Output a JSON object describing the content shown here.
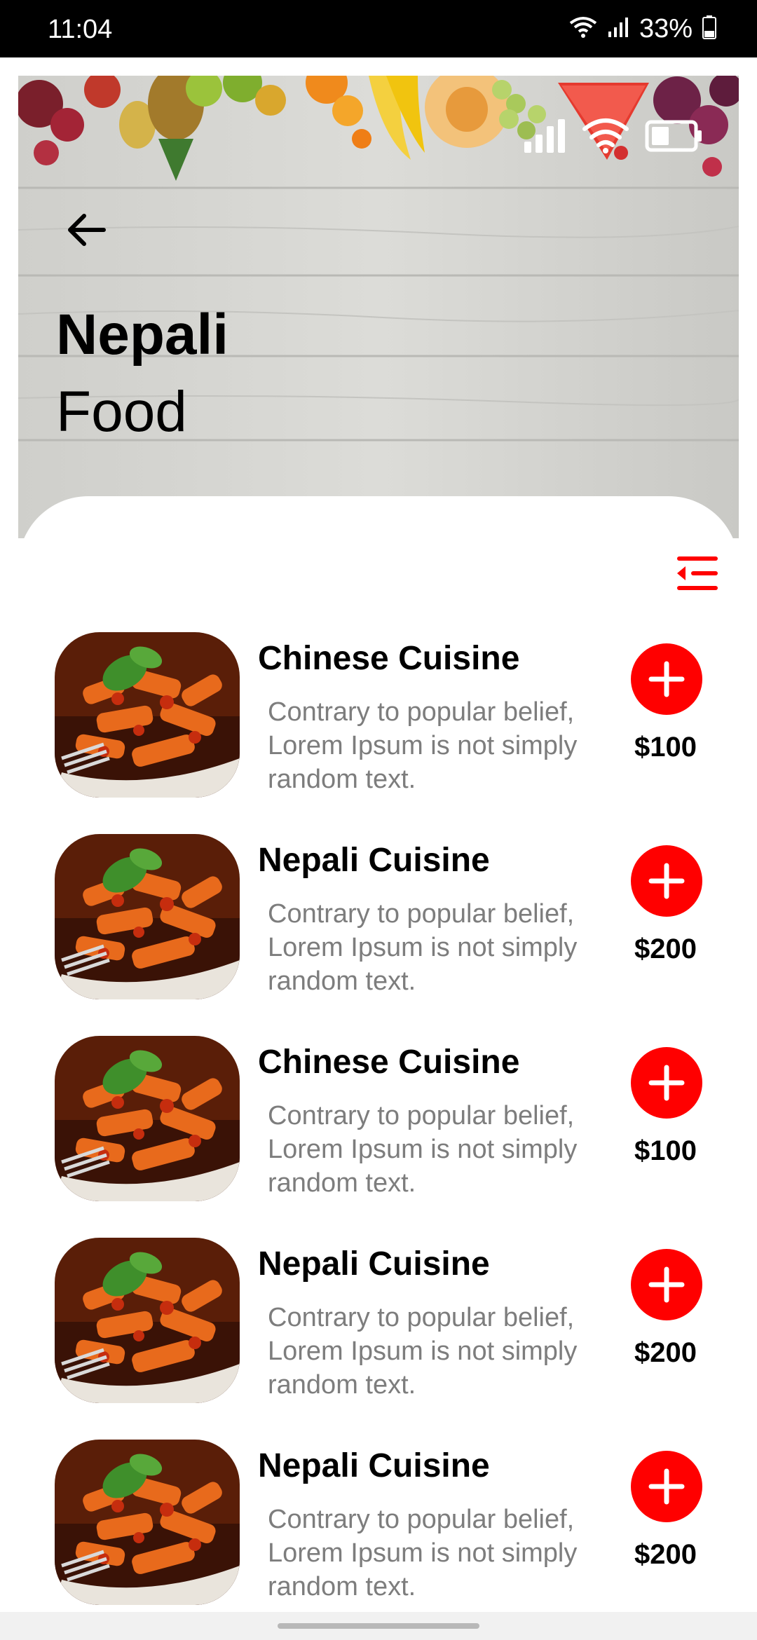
{
  "status_bar": {
    "time": "11:04",
    "battery": "33%"
  },
  "header": {
    "title_bold": "Nepali",
    "title_light": "Food"
  },
  "colors": {
    "accent": "#ff0000",
    "description": "#7d7d7d"
  },
  "items": [
    {
      "title": "Chinese Cuisine",
      "description": "Contrary to popular belief,\n Lorem Ipsum is not simply\nrandom text.",
      "price": "$100"
    },
    {
      "title": "Nepali Cuisine",
      "description": "Contrary to popular belief,\n Lorem Ipsum is not simply\nrandom text.",
      "price": "$200"
    },
    {
      "title": "Chinese Cuisine",
      "description": "Contrary to popular belief,\n Lorem Ipsum is not simply\nrandom text.",
      "price": "$100"
    },
    {
      "title": "Nepali Cuisine",
      "description": "Contrary to popular belief,\n Lorem Ipsum is not simply\nrandom text.",
      "price": "$200"
    },
    {
      "title": "Nepali Cuisine",
      "description": "Contrary to popular belief,\n Lorem Ipsum is not simply\nrandom text.",
      "price": "$200"
    }
  ]
}
